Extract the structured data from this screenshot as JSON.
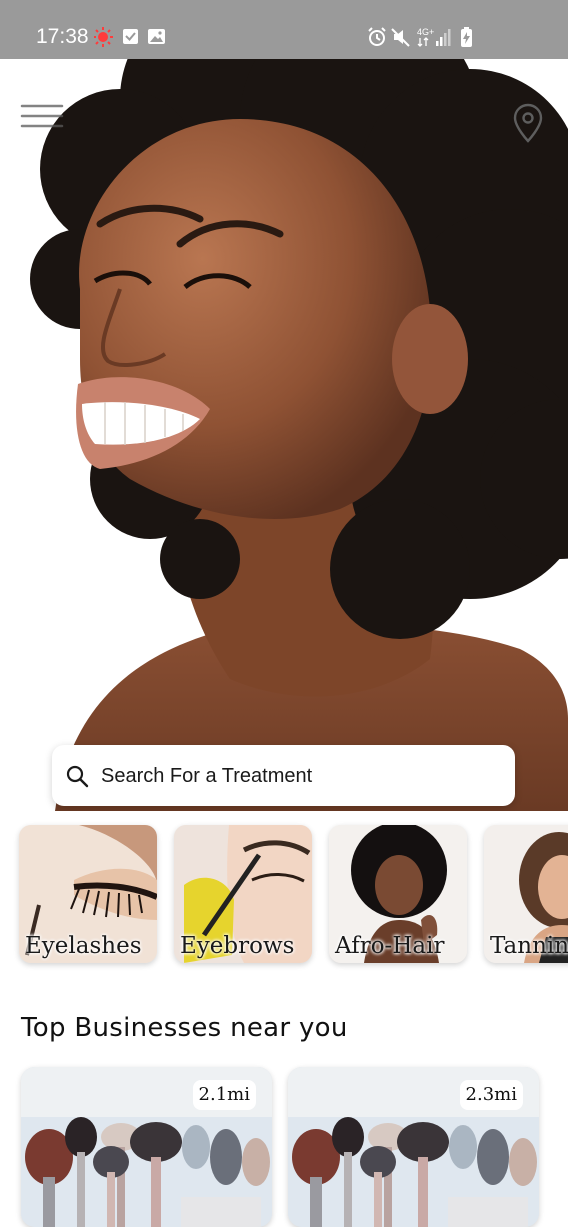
{
  "status_bar": {
    "time": "17:38",
    "left_icons": [
      "record-icon",
      "checkbox-notification-icon",
      "image-notification-icon"
    ],
    "right_icons": [
      "alarm-icon",
      "mute-icon",
      "network-4g-icon",
      "signal-icon",
      "battery-charging-icon"
    ],
    "network_label": "4G+"
  },
  "header": {
    "menu_icon": "hamburger-menu-icon",
    "location_icon": "location-pin-icon"
  },
  "search": {
    "placeholder": "Search For a Treatment",
    "icon": "search-icon"
  },
  "categories": [
    {
      "label": "Eyelashes"
    },
    {
      "label": "Eyebrows"
    },
    {
      "label": "Afro-Hair"
    },
    {
      "label": "Tanning"
    }
  ],
  "top_businesses": {
    "title": "Top Businesses near you",
    "items": [
      {
        "distance": "2.1mi"
      },
      {
        "distance": "2.3mi"
      }
    ]
  },
  "colors": {
    "status_bar": "#9a9a9a",
    "text": "#111111",
    "card_background": "#ffffff"
  }
}
